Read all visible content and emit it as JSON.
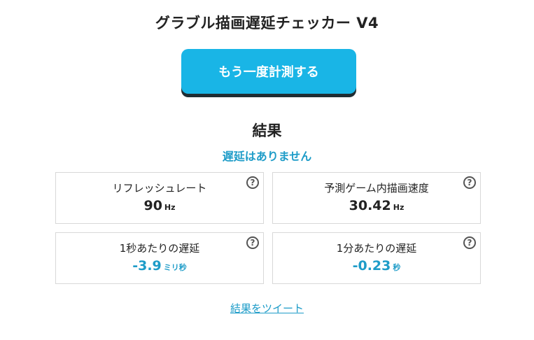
{
  "header": {
    "title": "グラブル描画遅延チェッカー V4"
  },
  "action": {
    "measure_label": "もう一度計測する"
  },
  "result": {
    "heading": "結果",
    "status": "遅延はありません",
    "cards": [
      {
        "label": "リフレッシュレート",
        "value": "90",
        "unit": "Hz",
        "help": "?"
      },
      {
        "label": "予測ゲーム内描画速度",
        "value": "30.42",
        "unit": "Hz",
        "help": "?"
      },
      {
        "label": "1秒あたりの遅延",
        "value": "-3.9",
        "unit": "ミリ秒",
        "help": "?"
      },
      {
        "label": "1分あたりの遅延",
        "value": "-0.23",
        "unit": "秒",
        "help": "?"
      }
    ]
  },
  "footer": {
    "tweet_label": "結果をツイート"
  },
  "colors": {
    "accent": "#19b5e6",
    "value_blue": "#1e9cc8",
    "card_border": "#d8d8d8"
  },
  "icons": {
    "help": "question-circle-icon"
  }
}
